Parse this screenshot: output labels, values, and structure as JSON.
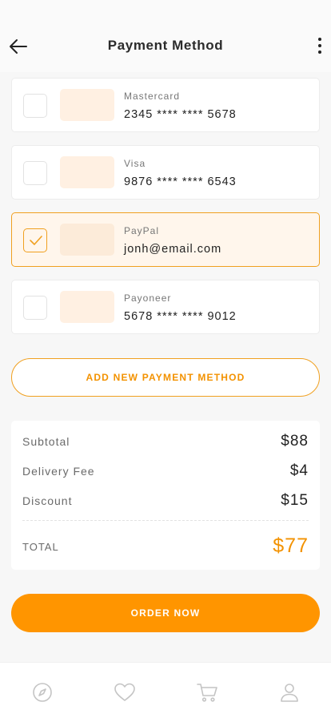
{
  "header": {
    "title": "Payment Method",
    "back_icon": "arrow-left-icon",
    "more_icon": "more-vertical-icon"
  },
  "payment_methods": [
    {
      "label": "Mastercard",
      "value": "2345 **** **** 5678",
      "selected": false
    },
    {
      "label": "Visa",
      "value": "9876 **** **** 6543",
      "selected": false
    },
    {
      "label": "PayPal",
      "value": "jonh@email.com",
      "selected": true
    },
    {
      "label": "Payoneer",
      "value": "5678 **** **** 9012",
      "selected": false
    }
  ],
  "add_button_label": "ADD NEW PAYMENT METHOD",
  "summary": {
    "subtotal_label": "Subtotal",
    "subtotal_value": "$88",
    "delivery_label": "Delivery Fee",
    "delivery_value": "$4",
    "discount_label": "Discount",
    "discount_value": "$15",
    "total_label": "TOTAL",
    "total_value": "$77"
  },
  "order_button_label": "ORDER NOW",
  "bottom_nav": {
    "items": [
      "compass-icon",
      "heart-icon",
      "cart-icon",
      "user-icon"
    ]
  },
  "colors": {
    "accent": "#ff9500",
    "accent_border": "#f0a020",
    "selected_bg": "#fff6ec",
    "logo_placeholder": "#fff0e2"
  }
}
